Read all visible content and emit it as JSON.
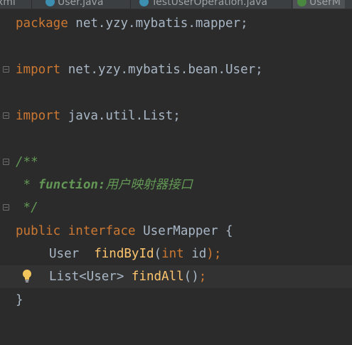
{
  "tabs": [
    {
      "label": "xml"
    },
    {
      "label": "User.java"
    },
    {
      "label": "TestUserOperation.java"
    },
    {
      "label": "UserM"
    }
  ],
  "code": {
    "line1": {
      "kw": "package",
      "rest": " net.yzy.mybatis.mapper;"
    },
    "line2": {
      "kw": "import",
      "rest": " net.yzy.mybatis.bean.User;"
    },
    "line3": {
      "kw": "import",
      "rest": " java.util.List;"
    },
    "line4": {
      "text": "/**"
    },
    "line5": {
      "star": " * ",
      "tag": "function:",
      "text": "用户映射器接口"
    },
    "line6": {
      "text": " */"
    },
    "line7": {
      "kw1": "public",
      "kw2": "interface",
      "name": "UserMapper",
      "brace": " {"
    },
    "line8": {
      "type": "User",
      "method": "findById",
      "open": "(",
      "ptype": "int",
      "pname": " id",
      "close": ");"
    },
    "line9": {
      "type": "List<User>",
      "method": "findAll",
      "parens": "()",
      "semi": ";"
    },
    "line10": {
      "text": "}"
    }
  },
  "colors": {
    "background": "#2b2b2b",
    "keyword": "#cc7832",
    "comment": "#629755",
    "method": "#ffc66d",
    "text": "#a9b7c6",
    "current_line": "#323232"
  },
  "icons": {
    "intention": "lightbulb-icon",
    "fold": "fold-marker-icon"
  }
}
